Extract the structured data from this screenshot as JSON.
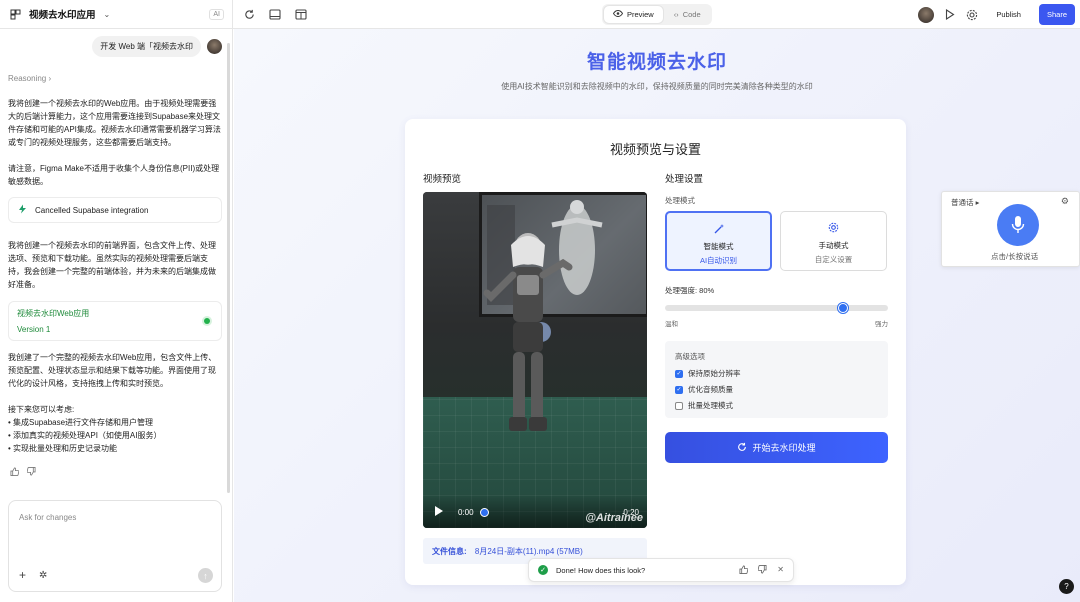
{
  "topbar": {
    "app_title": "视频去水印应用",
    "ai_badge": "AI",
    "tabs": [
      {
        "label": "Preview"
      },
      {
        "label": "Code"
      }
    ],
    "publish_label": "Publish",
    "share_label": "Share"
  },
  "chat": {
    "user_message": "开发 Web 端「视频去水印",
    "reasoning_label": "Reasoning",
    "para1": "我将创建一个视频去水印的Web应用。由于视频处理需要强大的后端计算能力，这个应用需要连接到Supabase来处理文件存储和可能的API集成。视频去水印通常需要机器学习算法或专门的视频处理服务，这些都需要后端支持。",
    "para2": "请注意，Figma Make不适用于收集个人身份信息(PII)或处理敏感数据。",
    "integration_card": "Cancelled Supabase integration",
    "para3": "我将创建一个视频去水印的前端界面，包含文件上传、处理选项、预览和下载功能。虽然实际的视频处理需要后端支持，我会创建一个完整的前端体验，并为未来的后端集成做好准备。",
    "version_title": "视频去水印Web应用",
    "version_sub": "Version 1",
    "para4": "我创建了一个完整的视频去水印Web应用，包含文件上传、预览配置、处理状态显示和结果下载等功能。界面使用了现代化的设计风格，支持拖拽上传和实时预览。",
    "next_title": "接下来您可以考虑:",
    "next_items": [
      "• 集成Supabase进行文件存储和用户管理",
      "• 添加真实的视频处理API（如使用AI服务）",
      "• 实现批量处理和历史记录功能"
    ],
    "input_placeholder": "Ask for changes"
  },
  "app": {
    "title": "智能视频去水印",
    "subtitle": "使用AI技术智能识别和去除视频中的水印，保持视频质量的同时完美清除各种类型的水印",
    "panel_title": "视频预览与设置",
    "preview_title": "视频预览",
    "settings_title": "处理设置",
    "video": {
      "time_current": "0:00",
      "time_total": "0:20",
      "watermark": "@Aitrainee"
    },
    "file_info_label": "文件信息:",
    "file_info_value": "8月24日-副本(11).mp4 (57MB)",
    "mode_label": "处理模式",
    "modes": [
      {
        "name": "智能模式",
        "desc": "AI自动识别",
        "selected": true
      },
      {
        "name": "手动模式",
        "desc": "自定义设置",
        "selected": false
      }
    ],
    "strength_label": "处理强度: 80%",
    "strength_value": 80,
    "slider_min_label": "温和",
    "slider_max_label": "强力",
    "advanced_title": "高级选项",
    "options": [
      {
        "label": "保持原始分辨率",
        "checked": true
      },
      {
        "label": "优化音频质量",
        "checked": true
      },
      {
        "label": "批量处理模式",
        "checked": false
      }
    ],
    "start_button": "开始去水印处理"
  },
  "voice_widget": {
    "language": "普通话",
    "hint": "点击/长按说话"
  },
  "toast": {
    "message": "Done! How does this look?"
  },
  "colors": {
    "accent": "#3b57f0",
    "title_blue": "#4b61e8",
    "success_green": "#1e9e49"
  }
}
